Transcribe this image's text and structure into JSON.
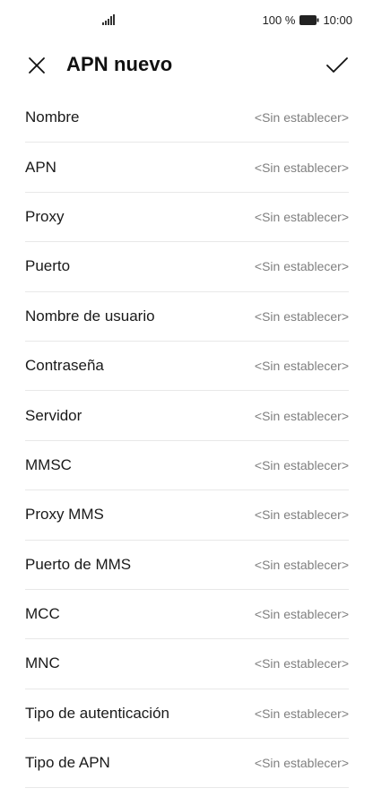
{
  "status_bar": {
    "battery_text": "100 %",
    "time": "10:00",
    "signal_icon": "signal-bars-icon",
    "battery_icon": "battery-full-icon"
  },
  "header": {
    "title": "APN nuevo",
    "close_icon": "close-icon",
    "confirm_icon": "checkmark-icon"
  },
  "fields": [
    {
      "label": "Nombre",
      "value": "<Sin establecer>"
    },
    {
      "label": "APN",
      "value": "<Sin establecer>"
    },
    {
      "label": "Proxy",
      "value": "<Sin establecer>"
    },
    {
      "label": "Puerto",
      "value": "<Sin establecer>"
    },
    {
      "label": "Nombre de usuario",
      "value": "<Sin establecer>"
    },
    {
      "label": "Contraseña",
      "value": "<Sin establecer>"
    },
    {
      "label": "Servidor",
      "value": "<Sin establecer>"
    },
    {
      "label": "MMSC",
      "value": "<Sin establecer>"
    },
    {
      "label": "Proxy MMS",
      "value": "<Sin establecer>"
    },
    {
      "label": "Puerto de MMS",
      "value": "<Sin establecer>"
    },
    {
      "label": "MCC",
      "value": "<Sin establecer>"
    },
    {
      "label": "MNC",
      "value": "<Sin establecer>"
    },
    {
      "label": "Tipo de autenticación",
      "value": "<Sin establecer>"
    },
    {
      "label": "Tipo de APN",
      "value": "<Sin establecer>"
    }
  ]
}
